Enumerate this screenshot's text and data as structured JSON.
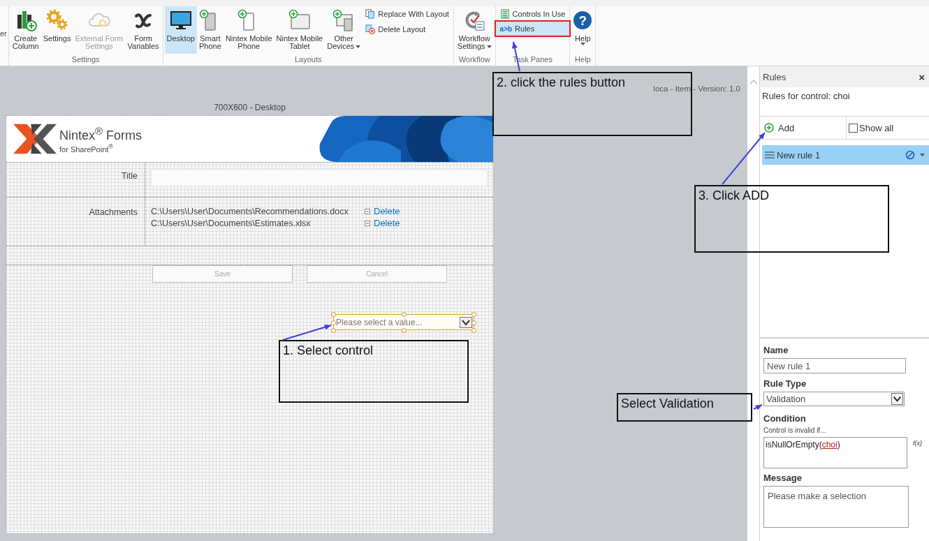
{
  "ribbon": {
    "clipped_label": "er",
    "groups": [
      {
        "label": "Settings",
        "items": [
          {
            "kind": "large",
            "lines": [
              "Create",
              "Column"
            ],
            "selected": false,
            "disabled": false,
            "menu": false,
            "outlined": false
          },
          {
            "kind": "large",
            "lines": [
              "Settings"
            ],
            "selected": false,
            "disabled": false,
            "menu": false,
            "outlined": false
          },
          {
            "kind": "large",
            "lines": [
              "External Form",
              "Settings"
            ],
            "selected": false,
            "disabled": true,
            "menu": false,
            "outlined": false
          },
          {
            "kind": "large",
            "lines": [
              "Form",
              "Variables"
            ],
            "selected": false,
            "disabled": false,
            "menu": false,
            "outlined": false
          }
        ]
      },
      {
        "label": "Layouts",
        "items": [
          {
            "kind": "large",
            "lines": [
              "Desktop"
            ],
            "selected": true,
            "disabled": false,
            "menu": false,
            "outlined": false
          },
          {
            "kind": "large",
            "lines": [
              "Smart",
              "Phone"
            ],
            "selected": false,
            "disabled": false,
            "menu": false,
            "outlined": false
          },
          {
            "kind": "large",
            "lines": [
              "Nintex Mobile",
              "Phone"
            ],
            "selected": false,
            "disabled": false,
            "menu": false,
            "outlined": false
          },
          {
            "kind": "large",
            "lines": [
              "Nintex Mobile",
              "Tablet"
            ],
            "selected": false,
            "disabled": false,
            "menu": false,
            "outlined": false
          },
          {
            "kind": "large",
            "lines": [
              "Other",
              "Devices"
            ],
            "selected": false,
            "disabled": false,
            "menu": true,
            "outlined": false
          },
          {
            "kind": "small",
            "lines": [
              "Replace With Layout"
            ],
            "selected": false,
            "disabled": false,
            "menu": false,
            "outlined": false
          },
          {
            "kind": "small",
            "lines": [
              "Delete Layout"
            ],
            "selected": false,
            "disabled": false,
            "menu": false,
            "outlined": false
          }
        ]
      },
      {
        "label": "Workflow",
        "items": [
          {
            "kind": "large",
            "lines": [
              "Workflow",
              "Settings"
            ],
            "selected": false,
            "disabled": false,
            "menu": true,
            "outlined": false
          }
        ]
      },
      {
        "label": "Task Panes",
        "items": [
          {
            "kind": "small",
            "lines": [
              "Controls In Use"
            ],
            "selected": false,
            "disabled": false,
            "menu": false,
            "outlined": false
          },
          {
            "kind": "small",
            "glyph": "a>b",
            "lines": [
              "Rules"
            ],
            "selected": true,
            "disabled": false,
            "menu": false,
            "outlined": true
          }
        ]
      },
      {
        "label": "Help",
        "items": [
          {
            "kind": "large",
            "glyph": "?",
            "lines": [
              "Help"
            ],
            "selected": false,
            "disabled": false,
            "menu": true,
            "outlined": false
          }
        ]
      }
    ]
  },
  "canvas": {
    "version_text": "loca - Item - Version: 1.0",
    "caption": "700X600 - Desktop",
    "form": {
      "logo_title": "Nintex$^{®}$ Forms",
      "logo_subtitle": "for SharePoint$^{®}$",
      "title_label": "Title",
      "attachments_label": "Attachments",
      "attachments": [
        {
          "path": "C:\\Users\\User\\Documents\\Recommendations.docx",
          "action": "Delete"
        },
        {
          "path": "C:\\Users\\User\\Documents\\Estimates.xlsx",
          "action": "Delete"
        }
      ],
      "buttons": [
        {
          "label": "Save",
          "disabled": true
        },
        {
          "label": "Cancel",
          "disabled": true
        }
      ],
      "dropdown": {
        "placeholder": "Please select a value...",
        "selected": true
      }
    }
  },
  "annotations": [
    {
      "text": "1. Select control"
    },
    {
      "text": "2. click the rules button"
    },
    {
      "text": "3. Click ADD"
    },
    {
      "text": "Select Validation"
    }
  ],
  "rules_panel": {
    "title": "Rules",
    "close": "×",
    "subtitle": "Rules for control: choi",
    "add_label": "Add",
    "show_all": {
      "label": "Show all",
      "checked": false
    },
    "rules": [
      {
        "name": "New rule 1",
        "selected": true
      }
    ],
    "name_label": "Name",
    "name_value": "New rule 1",
    "rule_type_label": "Rule Type",
    "rule_type_value": "Validation",
    "condition_label": "Condition",
    "condition_hint": "Control is invalid if...",
    "condition": [
      {
        "kind": "text",
        "text": "isNullOrEmpty("
      },
      {
        "kind": "reference",
        "text": "choi"
      },
      {
        "kind": "text",
        "text": ")"
      }
    ],
    "formula_glyph": "f(x)",
    "message_label": "Message",
    "message_value": "Please make a selection"
  }
}
